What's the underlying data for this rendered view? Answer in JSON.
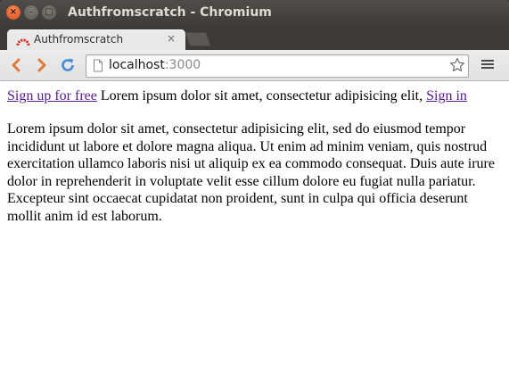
{
  "window": {
    "title": "Authfromscratch - Chromium",
    "close_glyph": "×",
    "minimize_glyph": "–",
    "maximize_glyph": "□"
  },
  "tab": {
    "title": "Authfromscratch",
    "close_glyph": "×",
    "favicon": "red-arc-icon"
  },
  "toolbar": {
    "url_host": "localhost",
    "url_port": ":3000",
    "icons": [
      "back-icon",
      "forward-icon",
      "reload-icon",
      "page-icon",
      "star-icon",
      "menu-icon"
    ]
  },
  "page": {
    "signup_link": "Sign up for free",
    "nav_text": " Lorem ipsum dolor sit amet, consectetur adipisicing elit, ",
    "signin_link": "Sign in",
    "paragraph": "Lorem ipsum dolor sit amet, consectetur adipisicing elit, sed do eiusmod tempor incididunt ut labore et dolore magna aliqua. Ut enim ad minim veniam, quis nostrud exercitation ullamco laboris nisi ut aliquip ex ea commodo consequat. Duis aute irure dolor in reprehenderit in voluptate velit esse cillum dolore eu fugiat nulla pariatur. Excepteur sint occaecat cupidatat non proident, sunt in culpa qui officia deserunt mollit anim id est laborum."
  },
  "colors": {
    "link_visited": "#551a8b",
    "titlebar": "#3c3b37",
    "close_button": "#e9541f",
    "nav_arrows": "#e0783a",
    "reload": "#4a8fd6"
  }
}
